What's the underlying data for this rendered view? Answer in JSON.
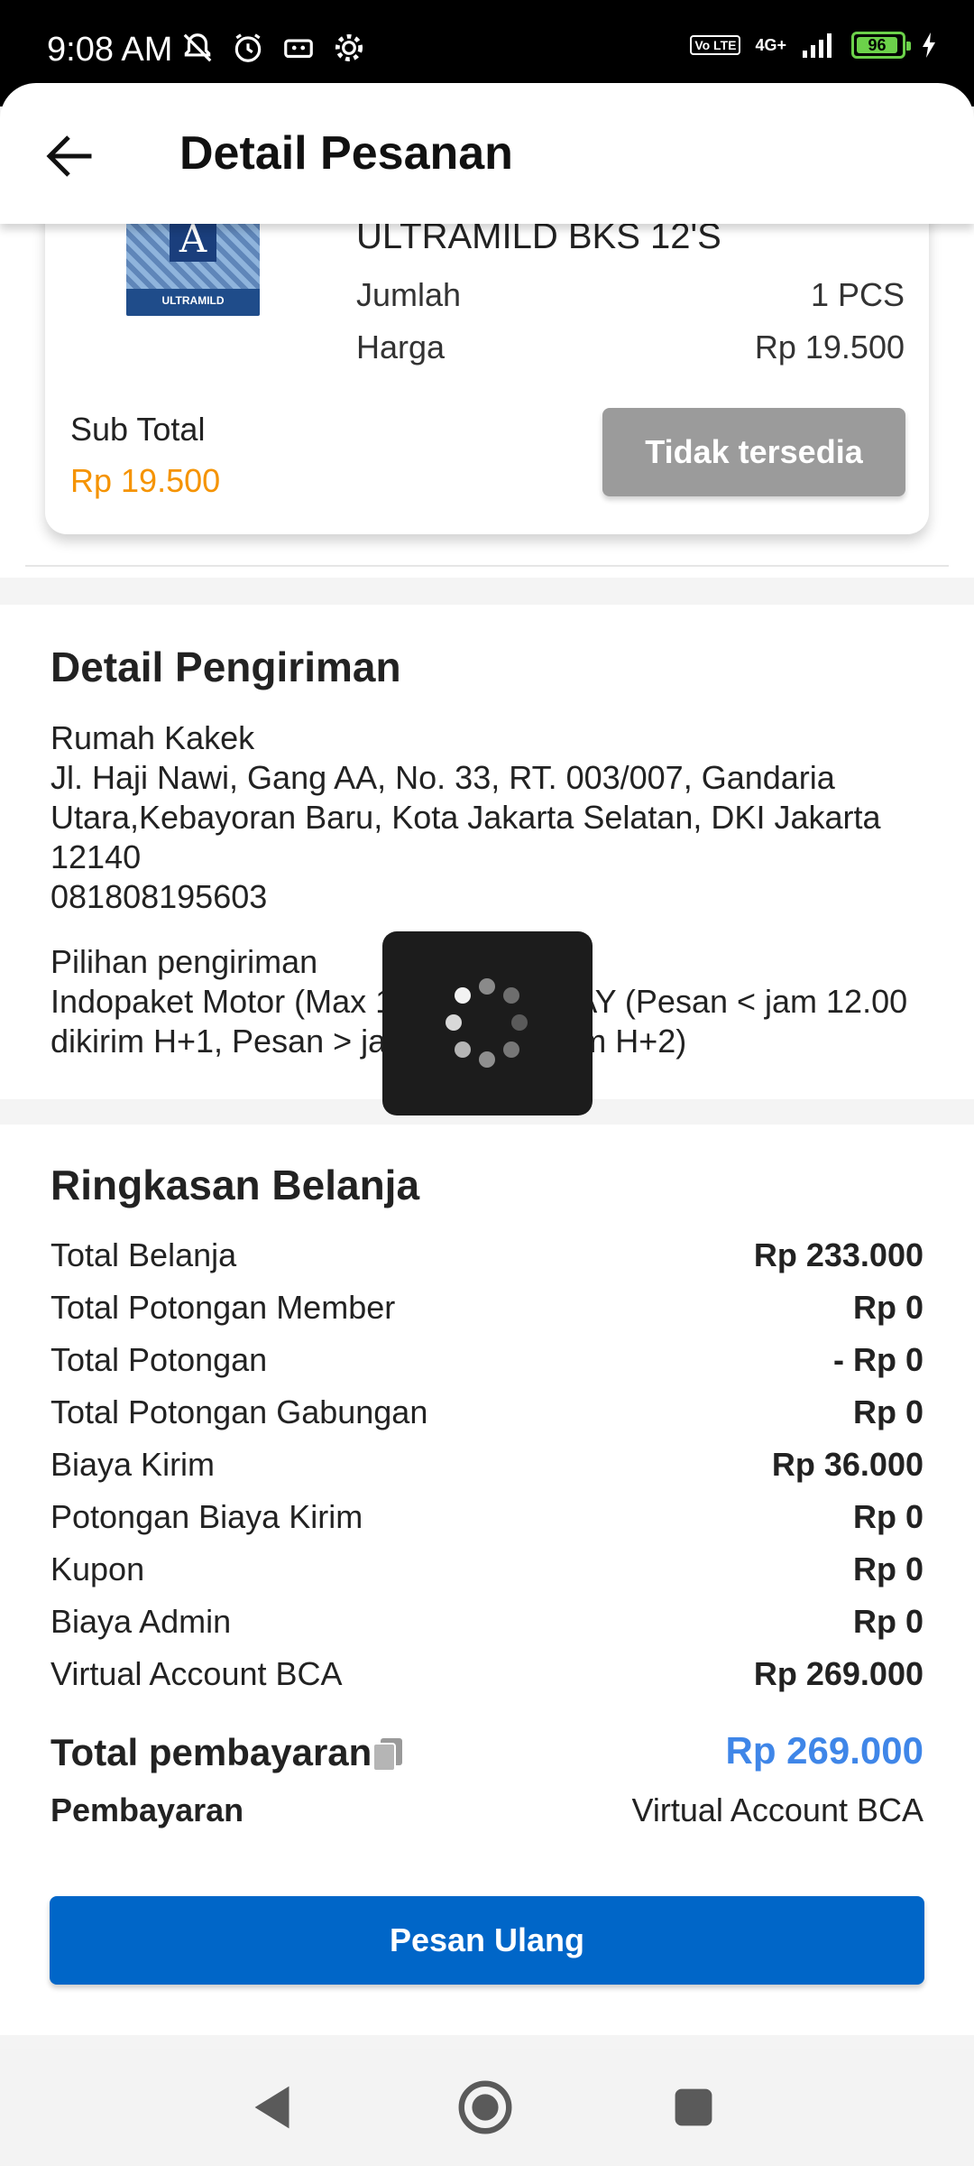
{
  "status_bar": {
    "time": "9:08 AM",
    "icons_left": [
      "mute-icon",
      "alarm-icon",
      "cassette-icon",
      "settings-icon"
    ],
    "volte": "Vo LTE",
    "network": "4G+",
    "battery": "96"
  },
  "header": {
    "title": "Detail Pesanan",
    "back_icon": "arrow-left-icon"
  },
  "product": {
    "name": "ULTRAMILD BKS 12'S",
    "qty_label": "Jumlah",
    "qty_value": "1 PCS",
    "price_label": "Harga",
    "price_value": "Rp 19.500",
    "subtotal_label": "Sub Total",
    "subtotal_value": "Rp 19.500",
    "status_button": "Tidak tersedia",
    "image_brand": "ULTRAMILD",
    "image_logo": "A"
  },
  "shipping": {
    "title": "Detail Pengiriman",
    "recipient": "Rumah Kakek",
    "address": "Jl. Haji Nawi, Gang AA, No. 33, RT. 003/007, Gandaria Utara,Kebayoran Baru, Kota Jakarta Selatan, DKI Jakarta 12140",
    "phone": "081808195603",
    "option_label": "Pilihan pengiriman",
    "option_value": "Indopaket Motor (Max 18kg) NEXTDAY  (Pesan < jam 12.00 dikirim H+1, Pesan > jam 12.00 dikirim H+2)"
  },
  "summary": {
    "title": "Ringkasan Belanja",
    "rows": [
      {
        "label": "Total Belanja",
        "value": "Rp 233.000"
      },
      {
        "label": "Total Potongan Member",
        "value": "Rp 0"
      },
      {
        "label": "Total Potongan",
        "value": "- Rp 0"
      },
      {
        "label": "Total Potongan Gabungan",
        "value": "Rp 0"
      },
      {
        "label": "Biaya Kirim",
        "value": "Rp 36.000"
      },
      {
        "label": "Potongan Biaya Kirim",
        "value": "Rp 0"
      },
      {
        "label": "Kupon",
        "value": "Rp 0"
      },
      {
        "label": "Biaya Admin",
        "value": "Rp 0"
      },
      {
        "label": "Virtual Account BCA",
        "value": "Rp 269.000"
      }
    ],
    "total_label": "Total pembayaran",
    "total_value": "Rp 269.000",
    "payment_label": "Pembayaran",
    "payment_value": "Virtual Account BCA"
  },
  "actions": {
    "reorder": "Pesan Ulang"
  },
  "colors": {
    "accent_orange": "#f59300",
    "total_blue": "#3f86e8",
    "primary_button": "#0066c8",
    "disabled_button": "#9b9b9b"
  },
  "nav": {
    "back": "nav-back-icon",
    "home": "nav-home-icon",
    "recents": "nav-recents-icon"
  }
}
